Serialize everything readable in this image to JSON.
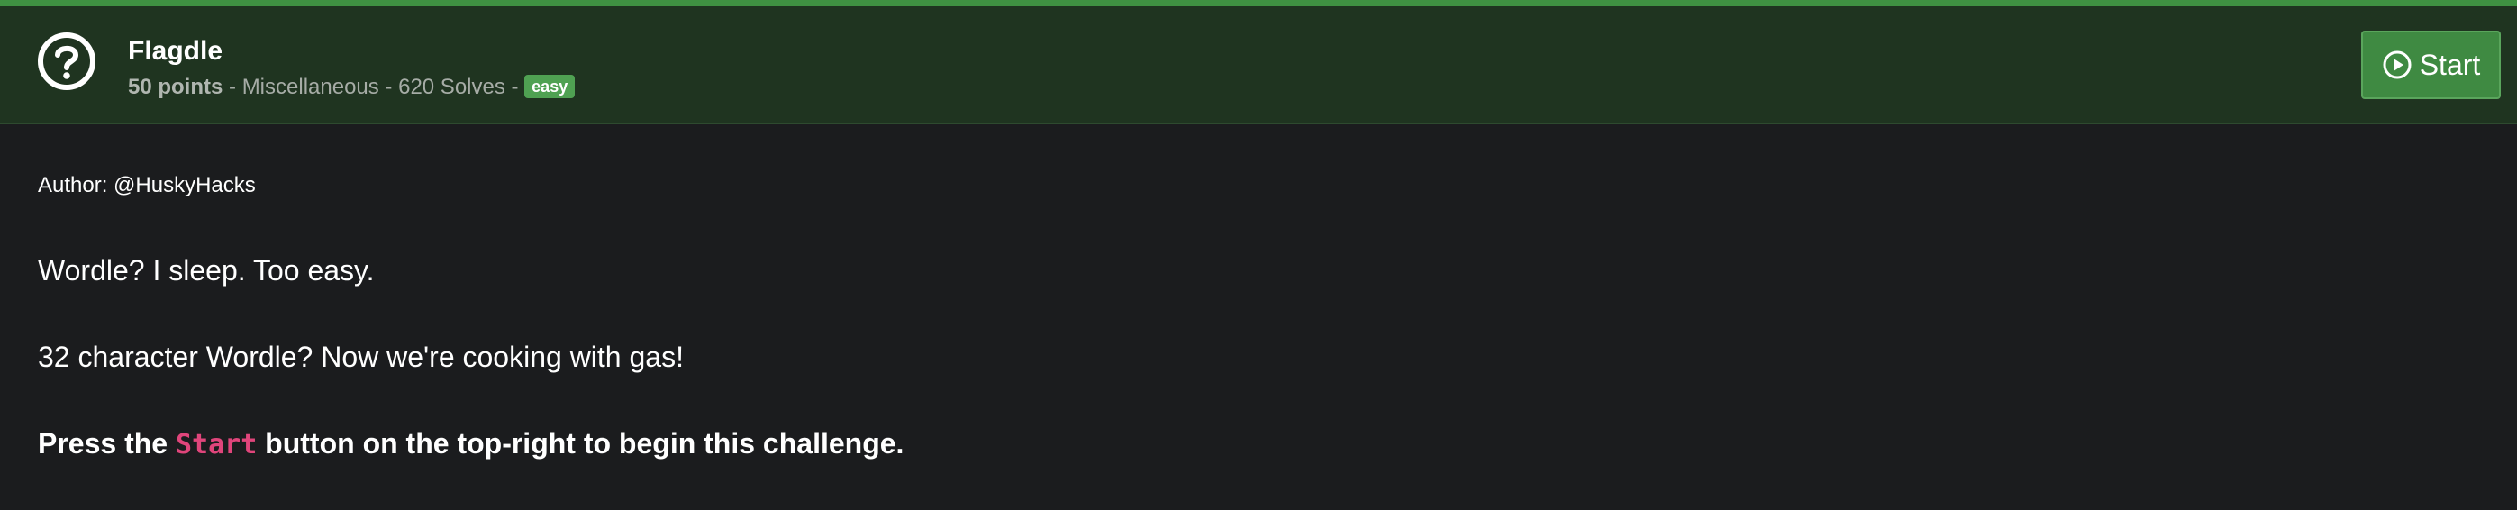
{
  "header": {
    "title": "Flagdle",
    "points": "50 points",
    "separator": " - ",
    "category": "Miscellaneous",
    "solves": "620 Solves",
    "difficulty": "easy",
    "start_label": "Start"
  },
  "icons": {
    "help": "question-circle-icon",
    "play": "play-circle-icon"
  },
  "colors": {
    "accent": "#3f9142",
    "header_bg": "#1f3420",
    "badge": "#4fa152",
    "code": "#e0457b"
  },
  "description": {
    "author": "Author: @HuskyHacks",
    "line1": "Wordle? I sleep. Too easy.",
    "line2": "32 character Wordle? Now we're cooking with gas!",
    "line3_prefix": "Press the ",
    "line3_code": "Start",
    "line3_suffix": " button on the top-right to begin this challenge."
  }
}
